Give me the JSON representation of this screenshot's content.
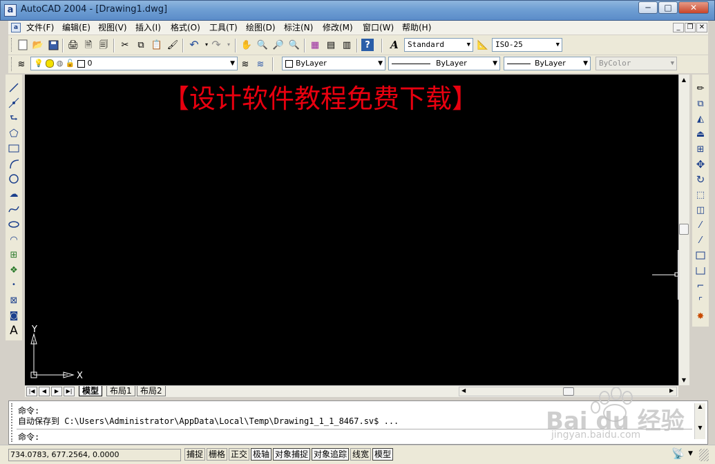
{
  "window": {
    "title": "AutoCAD 2004 - [Drawing1.dwg]",
    "app_icon_letter": "a",
    "controls": {
      "minimize": "─",
      "maximize": "□",
      "close": "✕"
    }
  },
  "menu": {
    "items": [
      "文件(F)",
      "编辑(E)",
      "视图(V)",
      "插入(I)",
      "格式(O)",
      "工具(T)",
      "绘图(D)",
      "标注(N)",
      "修改(M)",
      "窗口(W)",
      "帮助(H)"
    ],
    "doc_controls": {
      "minimize": "_",
      "restore": "❐",
      "close": "✕"
    }
  },
  "toolbar": {
    "text_style": "Standard",
    "dim_style": "ISO-25",
    "layer": "0",
    "color": "ByLayer",
    "linetype": "ByLayer",
    "lineweight": "ByLayer",
    "plot_style": "ByColor"
  },
  "canvas": {
    "watermark": "【设计软件教程免费下载】",
    "ucs_x": "X",
    "ucs_y": "Y"
  },
  "tabs": {
    "nav": [
      "|◀",
      "◀",
      "▶",
      "▶|"
    ],
    "items": [
      "模型",
      "布局1",
      "布局2"
    ],
    "active": "模型"
  },
  "command": {
    "lines": [
      "命令:",
      "自动保存到 C:\\Users\\Administrator\\AppData\\Local\\Temp\\Drawing1_1_1_8467.sv$ ...",
      "命令:"
    ]
  },
  "status": {
    "coordinates": "734.0783, 677.2564, 0.0000",
    "toggles": [
      {
        "label": "捕捉",
        "on": false
      },
      {
        "label": "栅格",
        "on": false
      },
      {
        "label": "正交",
        "on": false
      },
      {
        "label": "极轴",
        "on": true
      },
      {
        "label": "对象捕捉",
        "on": true
      },
      {
        "label": "对象追踪",
        "on": true
      },
      {
        "label": "线宽",
        "on": false
      },
      {
        "label": "模型",
        "on": true
      }
    ]
  },
  "corner_watermark": {
    "brand": "Bai du 经验",
    "url": "jingyan.baidu.com"
  }
}
